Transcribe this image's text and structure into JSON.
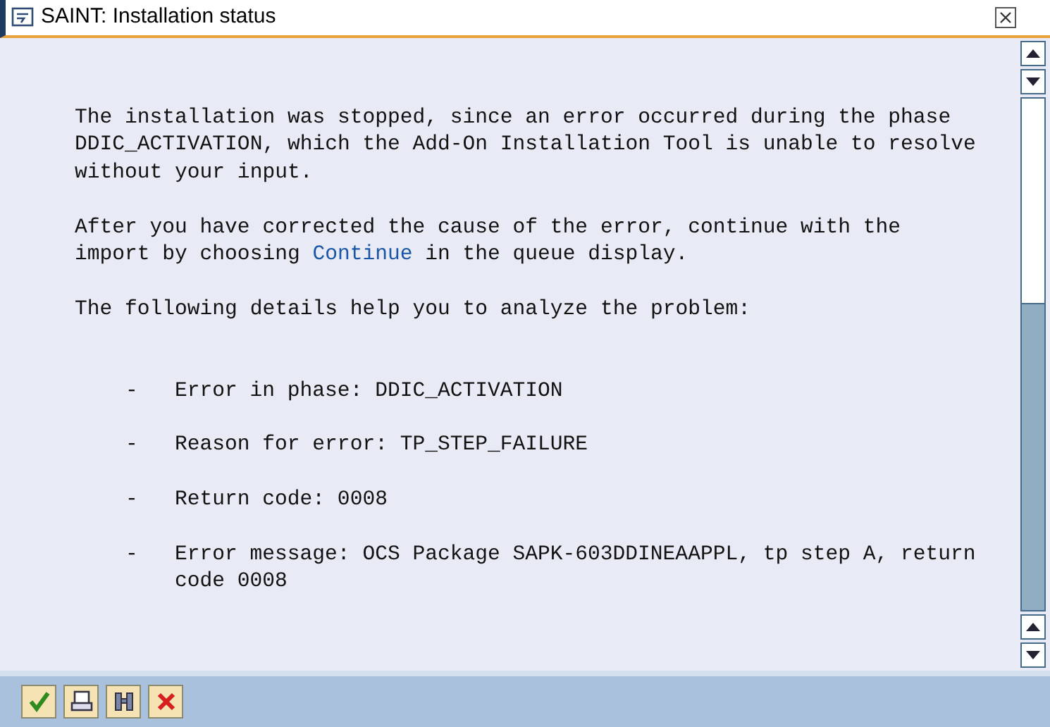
{
  "window": {
    "title": "SAINT: Installation status"
  },
  "paragraphs": [
    {
      "parts": [
        {
          "kind": "text",
          "text": "The installation was stopped, since an error occurred during the phase DDIC_ACTIVATION, which the Add-On Installation Tool is unable to resolve without your input."
        }
      ]
    },
    {
      "parts": [
        {
          "kind": "text",
          "text": "After you have corrected the cause of the error, continue with the import by choosing "
        },
        {
          "kind": "link",
          "text": "Continue"
        },
        {
          "kind": "text",
          "text": " in the queue display."
        }
      ]
    },
    {
      "parts": [
        {
          "kind": "text",
          "text": "The following details help you to analyze the problem:"
        }
      ]
    }
  ],
  "details": [
    {
      "bullet": "-",
      "text": "Error in phase: DDIC_ACTIVATION"
    },
    {
      "bullet": "-",
      "text": "Reason for error: TP_STEP_FAILURE"
    },
    {
      "bullet": "-",
      "text": "Return code: 0008"
    },
    {
      "bullet": "-",
      "text": "Error message: OCS Package SAPK-603DDINEAAPPL, tp step A, return code 0008"
    }
  ],
  "toolbar": [
    {
      "kind": "check"
    },
    {
      "kind": "print"
    },
    {
      "kind": "find"
    },
    {
      "kind": "cancel"
    }
  ]
}
